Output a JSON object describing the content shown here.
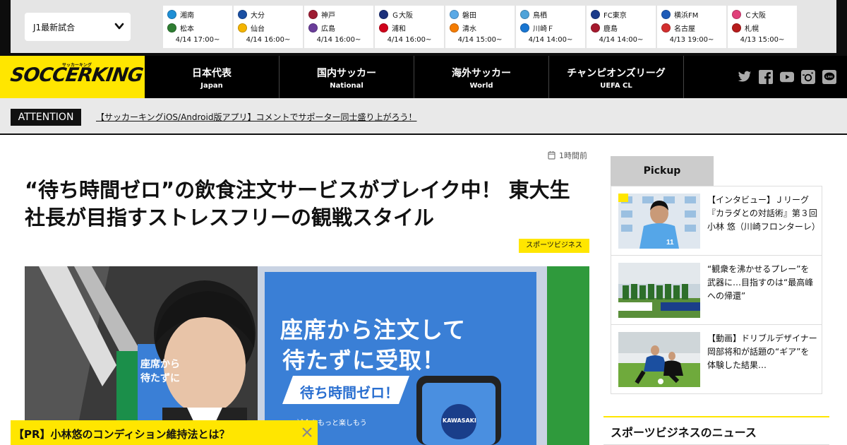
{
  "scorebar": {
    "league_select": "J1最新試合",
    "matches": [
      {
        "home": "湘南",
        "away": "松本",
        "time": "4/14 17:00~",
        "home_color": "#1e8fd6",
        "away_color": "#2e7d32"
      },
      {
        "home": "大分",
        "away": "仙台",
        "time": "4/14 16:00~",
        "home_color": "#1a4fa3",
        "away_color": "#f4b400"
      },
      {
        "home": "神戸",
        "away": "広島",
        "time": "4/14 16:00~",
        "home_color": "#9e1b32",
        "away_color": "#6a3d9a"
      },
      {
        "home": "Ｇ大阪",
        "away": "浦和",
        "time": "4/14 16:00~",
        "home_color": "#1b2f7a",
        "away_color": "#d0021b"
      },
      {
        "home": "磐田",
        "away": "清水",
        "time": "4/14 15:00~",
        "home_color": "#5aa9e6",
        "away_color": "#f57c00"
      },
      {
        "home": "鳥栖",
        "away": "川崎Ｆ",
        "time": "4/14 14:00~",
        "home_color": "#4fa3d9",
        "away_color": "#1976d2"
      },
      {
        "home": "FC東京",
        "away": "鹿島",
        "time": "4/14 14:00~",
        "home_color": "#1a3a8a",
        "away_color": "#a6192e"
      },
      {
        "home": "横浜FM",
        "away": "名古屋",
        "time": "4/13 19:00~",
        "home_color": "#1e5bb8",
        "away_color": "#d32f2f"
      },
      {
        "home": "Ｃ大阪",
        "away": "札幌",
        "time": "4/13 15:00~",
        "home_color": "#e0407a",
        "away_color": "#b71c1c"
      }
    ]
  },
  "header": {
    "logo_text": "SOCCERKING",
    "logo_kana": "サッカーキング",
    "nav": [
      {
        "jp": "日本代表",
        "en": "Japan"
      },
      {
        "jp": "国内サッカー",
        "en": "National"
      },
      {
        "jp": "海外サッカー",
        "en": "World"
      },
      {
        "jp": "チャンピオンズリーグ",
        "en": "UEFA CL"
      }
    ],
    "social_icons": [
      "twitter-icon",
      "facebook-icon",
      "youtube-icon",
      "instagram-icon",
      "line-icon"
    ]
  },
  "attention": {
    "label": "ATTENTION",
    "link_text": "【サッカーキングiOS/Android版アプリ】コメントでサポーター同士盛り上がろう！"
  },
  "article": {
    "time_ago": "1時間前",
    "title": "“待ち時間ゼロ”の飲食注文サービスがブレイク中！ 東大生社長が目指すストレスフリーの観戦スタイル",
    "tag": "スポーツビジネス",
    "sign_line1": "座席から注文して",
    "sign_line2": "待たずに受取！",
    "sign_banner": "待ち時間ゼロ！",
    "sign_small": "試合をもっと楽しもう",
    "sign_left": "座席から",
    "sign_left2": "待たずに",
    "club": "KAWASAKI"
  },
  "pr": {
    "text": "【PR】小林悠のコンディション維持法とは？"
  },
  "sidebar": {
    "pickup_label": "Pickup",
    "items": [
      {
        "text": "【インタビュー】Ｊリーグ『カラダとの対話術』第３回 小林 悠（川崎フロンターレ）"
      },
      {
        "text": "“観衆を沸かせるプレー”を武器に…目指すのは“最高峰への帰還”"
      },
      {
        "text": "【動画】ドリブルデザイナー岡部将和が話題の“ギア”を体験した結果…"
      }
    ],
    "news_heading": "スポーツビジネスのニュース"
  }
}
